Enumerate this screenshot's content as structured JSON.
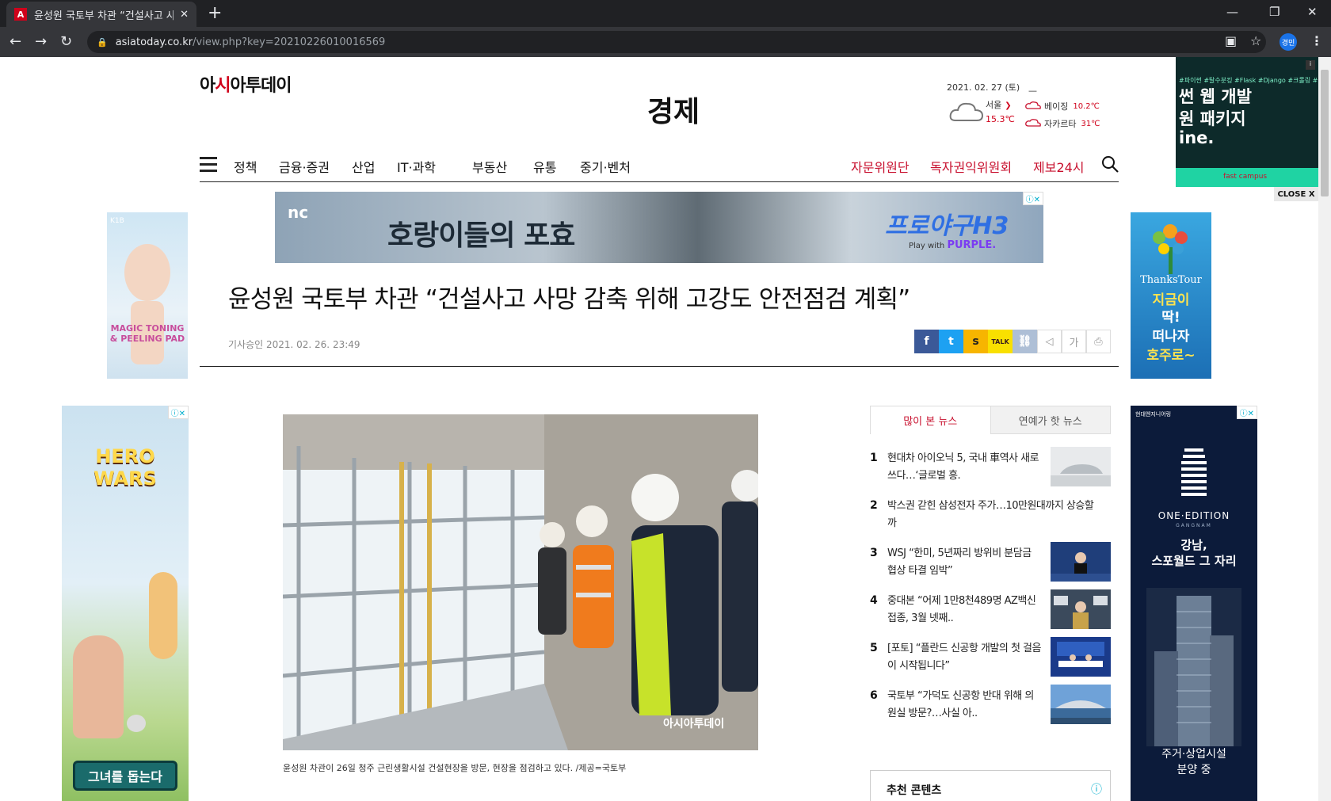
{
  "browser": {
    "tab_title": "윤성원 국토부 차관 “건설사고 사",
    "favicon": "A",
    "new_tab": "+",
    "url_host": "asiatoday.co.kr",
    "url_path": "/view.php?key=20210226010016569",
    "profile": "경민"
  },
  "site": {
    "logo_pre": "아",
    "logo_red": "시",
    "logo_post": "아투데이",
    "section": "경제"
  },
  "weather": {
    "date": "2021. 02. 27 (토)",
    "city": "서울",
    "temp": "15.3℃",
    "dash": "—",
    "others": [
      {
        "city": "베이징",
        "temp": "10.2℃"
      },
      {
        "city": "자카르타",
        "temp": "31℃"
      }
    ]
  },
  "nav": {
    "items": [
      "정책",
      "금융·증권",
      "산업",
      "IT·과학",
      "부동산",
      "유통",
      "중기·벤처"
    ],
    "right": [
      "자문위원단",
      "독자권익위원회",
      "제보24시"
    ]
  },
  "ads": {
    "top": {
      "brand": "nc",
      "slogan": "호랑이들의 포효",
      "product": "프로야구H3",
      "play": "Play with",
      "platform": "PURPLE."
    },
    "left_small": {
      "brand": "K1B",
      "text": "MAGIC TONING & PEELING PAD"
    },
    "right_small": {
      "brand": "ThanksTour",
      "lines": [
        "지금이",
        "딱!",
        "떠나자",
        "호주로~"
      ]
    },
    "left_big": {
      "title": "HERO WARS",
      "cta": "그녀를 돕는다"
    },
    "right_big": {
      "top": "현대엔지니어링",
      "name": "ONE·EDITION",
      "area": "GANGNAM",
      "headline1": "강남,",
      "headline2": "스포월드 그 자리",
      "bottom1": "주거·상업시설",
      "bottom2": "분양 중"
    },
    "floating": {
      "tags": "#파이썬 #탈수분킹 #Flask #Django #크롤링 #실전",
      "l1": "썬 웹 개발",
      "l2": "원 패키지",
      "l3": "ine.",
      "brand": "fast campus",
      "badge": "i"
    },
    "close": "CLOSE X"
  },
  "article": {
    "headline": "윤성원 국토부 차관 “건설사고 사망 감축 위해 고강도 안전점검 계획”",
    "byline": "기사승인 2021. 02. 26. 23:49",
    "share": {
      "fb": "f",
      "tw": "t",
      "ks": "s",
      "kt": "TALK",
      "link": "⛓",
      "speaker": "◁",
      "font": "가",
      "print": "⎙"
    },
    "photo_watermark": "아시아투데이",
    "caption": "윤성원 차관이 26일 청주 근린생활시설 건설현장을 방문, 현장을 점검하고 있다. /제공=국토부"
  },
  "ranking": {
    "tabs": [
      "많이 본 뉴스",
      "연예가 핫 뉴스"
    ],
    "items": [
      {
        "num": "1",
        "text": "현대차 아이오닉 5, 국내 車역사 새로 쓰다…‘글로벌 흥."
      },
      {
        "num": "2",
        "text": "박스권 갇힌 삼성전자 주가…10만원대까지 상승할까"
      },
      {
        "num": "3",
        "text": "WSJ “한미, 5년짜리 방위비 분담금 협상 타결 임박”"
      },
      {
        "num": "4",
        "text": "중대본 “어제 1만8천489명 AZ백신 접종, 3월 넷째.."
      },
      {
        "num": "5",
        "text": "[포토] “플란드 신공항 개발의 첫 걸음이 시작됩니다”"
      },
      {
        "num": "6",
        "text": "국토부 “가덕도 신공항 반대 위해 의원실 방문?…사실 아.."
      }
    ]
  },
  "recommend": {
    "title": "추천 콘텐츠"
  }
}
